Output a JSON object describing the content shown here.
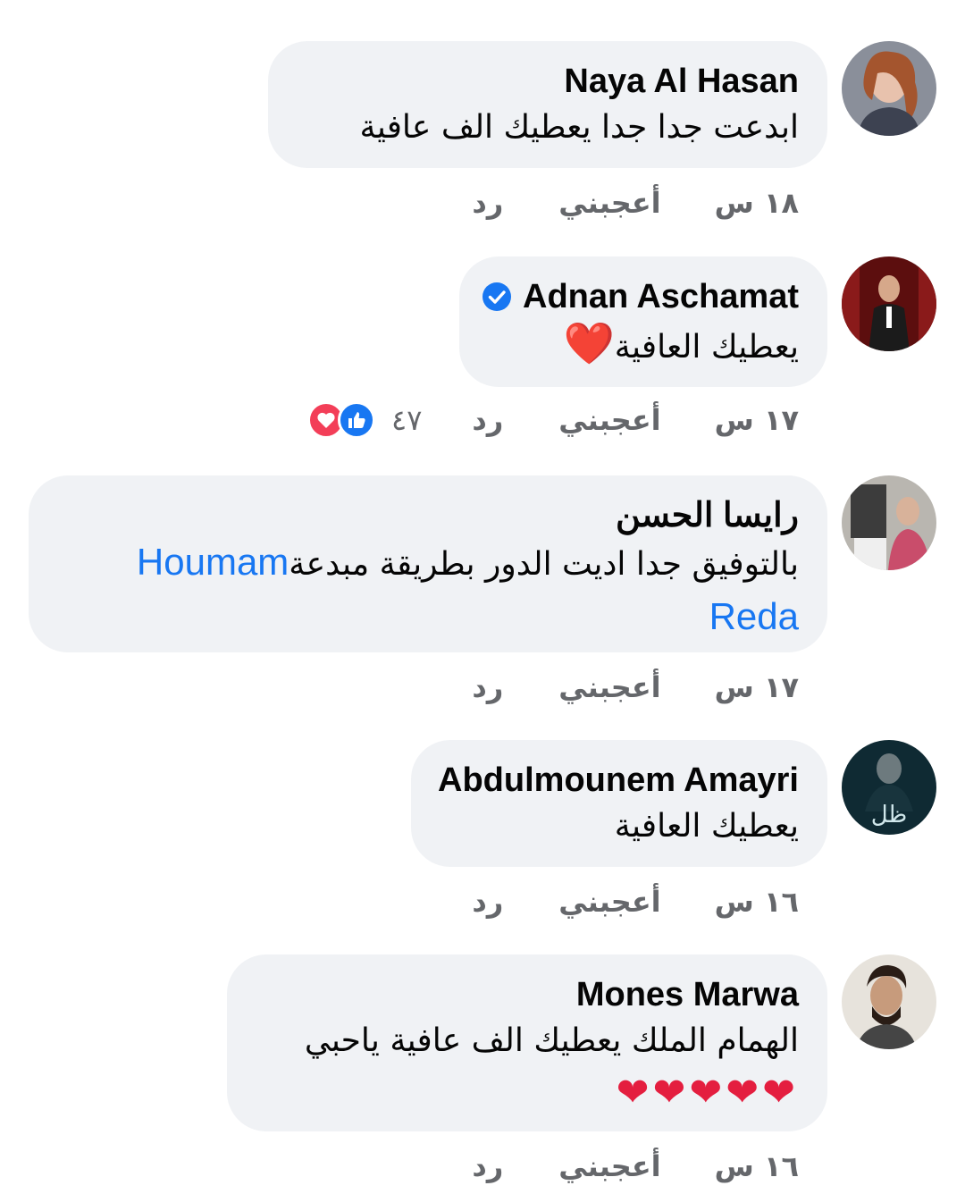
{
  "colors": {
    "bubble": "#f0f2f5",
    "meta_text": "#65676b",
    "link": "#1877f2",
    "heart": "#e41e3f",
    "love_reaction": "#f33e58",
    "like_reaction": "#1877f2"
  },
  "comments": [
    {
      "author": "Naya Al Hasan",
      "text": "ابدعت جدا جدا يعطيك الف عافية",
      "time": "١٨ س",
      "like_label": "أعجبني",
      "reply_label": "رد"
    },
    {
      "author": "Adnan Aschamat",
      "verified": true,
      "text": "يعطيك العافية",
      "heart": "❤️",
      "time": "١٧ س",
      "like_label": "أعجبني",
      "reply_label": "رد",
      "reaction_count": "٤٧",
      "reactions": [
        "like-icon",
        "love-icon"
      ]
    },
    {
      "author": "رايسا الحسن",
      "text": "بالتوفيق جدا اديت الدور بطريقة مبدعة",
      "mention_line1": "Houmam",
      "mention_line2": "Reda",
      "time": "١٧ س",
      "like_label": "أعجبني",
      "reply_label": "رد"
    },
    {
      "author": "Abdulmounem Amayri",
      "text": "يعطيك العافية",
      "time": "١٦ س",
      "like_label": "أعجبني",
      "reply_label": "رد"
    },
    {
      "author": "Mones Marwa",
      "text": "الهمام الملك يعطيك الف عافية ياحبي",
      "hearts": "❤❤❤❤❤",
      "time": "١٦ س",
      "like_label": "أعجبني",
      "reply_label": "رد"
    }
  ]
}
